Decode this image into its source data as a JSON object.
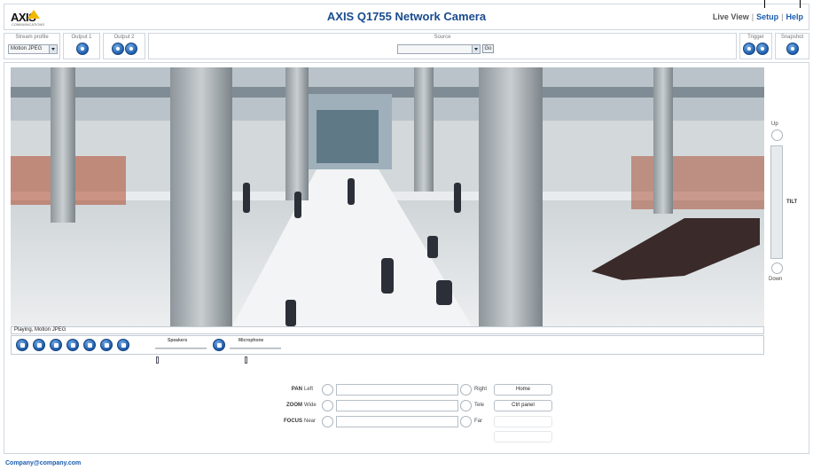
{
  "header": {
    "logo_text": "AXIS",
    "logo_subtext": "COMMUNICATIONS",
    "title": "AXIS Q1755 Network Camera",
    "nav": {
      "live_view": "Live View",
      "setup": "Setup",
      "help": "Help",
      "separator": "|"
    }
  },
  "toolbar": {
    "stream_profile": {
      "label": "Stream profile",
      "value": "Motion JPEG"
    },
    "output1": {
      "label": "Output 1"
    },
    "output2": {
      "label": "Output 2"
    },
    "source": {
      "label": "Source",
      "value": "",
      "go_label": "Go"
    },
    "trigger": {
      "label": "Trigger"
    },
    "snapshot": {
      "label": "Snapshot"
    }
  },
  "video": {
    "status_text": "Playing, Motion JPEG",
    "controls": [
      "stop-icon",
      "snapshot-icon",
      "fullscreen-icon",
      "record-icon",
      "play-icon",
      "zoom-icon",
      "speaker-icon"
    ],
    "speakers_label": "Speakers",
    "speakers_level": 0.02,
    "microphone_label": "Microphone",
    "microphone_level": 0.3
  },
  "tilt": {
    "up_label": "Up",
    "label": "TILT",
    "down_label": "Down"
  },
  "ptz": {
    "pan": {
      "name": "PAN",
      "min": "Left",
      "max": "Right",
      "button": "Home"
    },
    "zoom": {
      "name": "ZOOM",
      "min": "Wide",
      "max": "Tele",
      "button": "Ctrl panel"
    },
    "focus": {
      "name": "FOCUS",
      "min": "Near",
      "max": "Far"
    }
  },
  "footer": {
    "email": "Company@company.com"
  },
  "colors": {
    "accent": "#1a5db0",
    "title": "#1a4b8e",
    "logo": "#f2b800"
  }
}
